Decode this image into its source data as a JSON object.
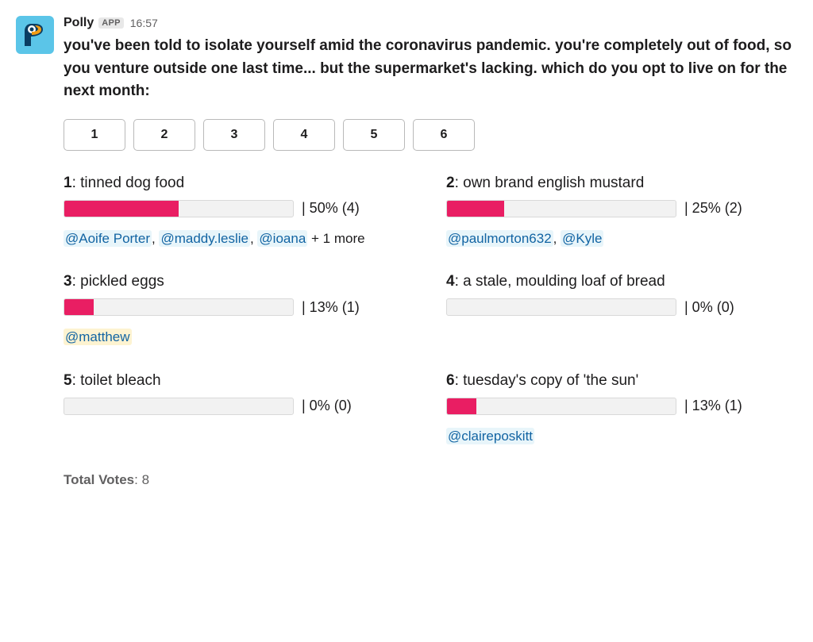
{
  "header": {
    "app_name": "Polly",
    "app_badge": "APP",
    "timestamp": "16:57"
  },
  "question": "you've been told to isolate yourself amid the coronavirus pandemic. you're completely out of food, so you venture outside one last time... but the supermarket's lacking. which do you opt to live on for the next month:",
  "vote_buttons": [
    "1",
    "2",
    "3",
    "4",
    "5",
    "6"
  ],
  "results": [
    {
      "num": "1",
      "label": "tinned dog food",
      "percent": 50,
      "percent_display": "50% (4)",
      "voters": [
        "@Aoife Porter",
        "@maddy.leslie",
        "@ioana"
      ],
      "more_suffix": " + 1 more",
      "highlight": []
    },
    {
      "num": "2",
      "label": "own brand english mustard",
      "percent": 25,
      "percent_display": "25% (2)",
      "voters": [
        "@paulmorton632",
        "@Kyle"
      ],
      "more_suffix": "",
      "highlight": []
    },
    {
      "num": "3",
      "label": "pickled eggs",
      "percent": 13,
      "percent_display": "13% (1)",
      "voters": [
        "@matthew"
      ],
      "more_suffix": "",
      "highlight": [
        "@matthew"
      ]
    },
    {
      "num": "4",
      "label": "a stale, moulding loaf of bread",
      "percent": 0,
      "percent_display": "0% (0)",
      "voters": [],
      "more_suffix": "",
      "highlight": []
    },
    {
      "num": "5",
      "label": "toilet bleach",
      "percent": 0,
      "percent_display": "0% (0)",
      "voters": [],
      "more_suffix": "",
      "highlight": []
    },
    {
      "num": "6",
      "label": "tuesday's copy of 'the sun'",
      "percent": 13,
      "percent_display": "13% (1)",
      "voters": [
        "@claireposkitt"
      ],
      "more_suffix": "",
      "highlight": []
    }
  ],
  "total_votes": {
    "label": "Total Votes",
    "value": "8"
  }
}
